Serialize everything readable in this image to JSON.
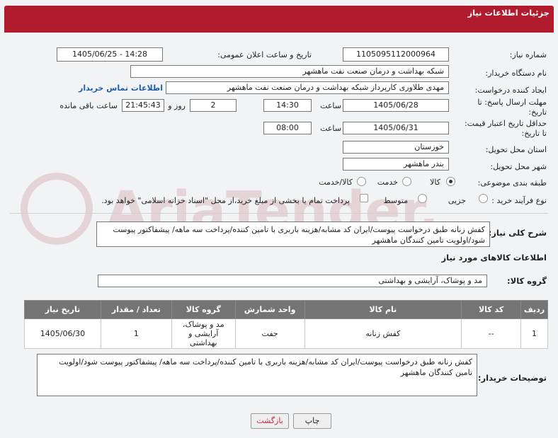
{
  "header": {
    "title": "جزئیات اطلاعات نیاز"
  },
  "fields": {
    "need_number_label": "شماره نیاز:",
    "need_number": "1105095112000964",
    "announce_label": "تاریخ و ساعت اعلان عمومی:",
    "announce_value": "1405/06/25 - 14:28",
    "buyer_org_label": "نام دستگاه خریدار:",
    "buyer_org": "شبکه بهداشت و درمان صنعت نفت ماهشهر",
    "requester_label": "ایجاد کننده درخواست:",
    "requester": "مهدی طلاوری کارپرداز شبکه بهداشت و درمان صنعت نفت ماهشهر",
    "contact_link": "اطلاعات تماس خریدار",
    "deadline_label_1": "مهلت ارسال پاسخ: تا",
    "deadline_label_2": "تاریخ:",
    "deadline_date": "1405/06/28",
    "hour_label": "ساعت",
    "deadline_time": "14:30",
    "days_value": "2",
    "days_label": "روز و",
    "remaining_time": "21:45:43",
    "remaining_label": "ساعت باقی مانده",
    "price_validity_label_1": "حداقل تاریخ اعتبار قیمت:",
    "price_validity_label_2": "تا تاریخ:",
    "price_validity_date": "1405/06/31",
    "price_validity_time": "08:00",
    "province_label": "استان محل تحویل:",
    "province": "خوزستان",
    "city_label": "شهر محل تحویل:",
    "city": "بندر ماهشهر",
    "category_label": "طبقه بندی موضوعی:",
    "category_options": [
      "کالا",
      "خدمت",
      "کالا/خدمت"
    ],
    "process_label": "نوع فرآیند خرید :",
    "process_options": [
      "جزیی",
      "متوسط"
    ],
    "payment_note": "پرداخت تمام یا بخشی از مبلغ خرید،از محل \"اسناد خزانه اسلامی\" خواهد بود.",
    "description_label": "شرح کلی نیاز:",
    "description": "کفش زنانه طبق درخواست پیوست/ایران کد مشابه/هزینه باربری با تامین کننده/پرداخت سه ماهه/ پیشفاکتور پیوست شود/اولویت تامین کنندگان ماهشهر"
  },
  "items_section": {
    "title": "اطلاعات کالاهای مورد نیاز",
    "group_label": "گروه کالا:",
    "group_value": "مد و پوشاک، آرایشی و بهداشتی",
    "columns": [
      "ردیف",
      "کد کالا",
      "نام کالا",
      "واحد شمارش",
      "گروه کالا",
      "تعداد / مقدار",
      "تاریخ نیاز"
    ],
    "rows": [
      {
        "row": "1",
        "code": "--",
        "name": "کفش زنانه",
        "unit": "جفت",
        "group_lines": [
          "مد و پوشاک،",
          "آرایشی و",
          "بهداشتی"
        ],
        "qty": "1",
        "date": "1405/06/30"
      }
    ]
  },
  "buyer_notes": {
    "label": "توضیحات خریدار:",
    "text": "کفش زنانه طبق درخواست پیوست/ایران کد مشابه/هزینه باربری با تامین کننده/پرداخت سه ماهه/ پیشفاکتور پیوست شود/اولویت تامین کنندگان ماهشهر"
  },
  "buttons": {
    "print": "چاپ",
    "back": "بازگشت"
  },
  "watermark": {
    "text": "AriaTender.net"
  },
  "colors": {
    "header": "#b01c2d",
    "back_button": "#c0283a",
    "link": "#1f5fa8",
    "table_header": "#747474"
  }
}
